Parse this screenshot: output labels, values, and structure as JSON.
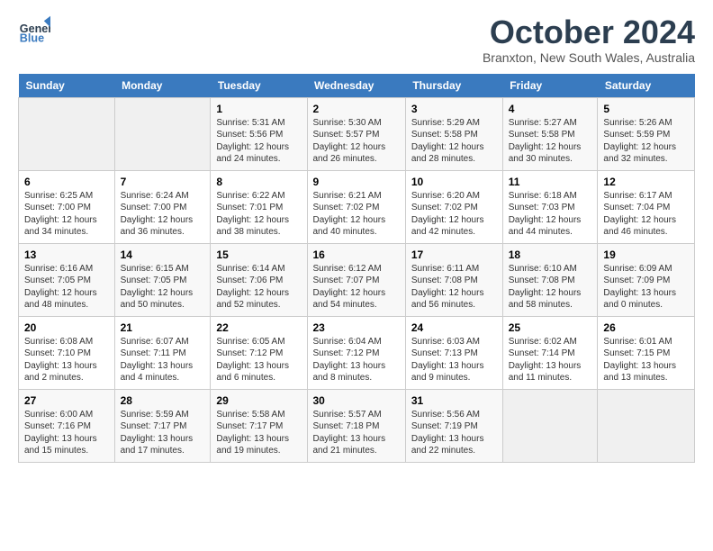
{
  "logo": {
    "line1": "General",
    "line2": "Blue"
  },
  "title": "October 2024",
  "subtitle": "Branxton, New South Wales, Australia",
  "days_of_week": [
    "Sunday",
    "Monday",
    "Tuesday",
    "Wednesday",
    "Thursday",
    "Friday",
    "Saturday"
  ],
  "weeks": [
    [
      {
        "day": "",
        "empty": true
      },
      {
        "day": "",
        "empty": true
      },
      {
        "day": "1",
        "sunrise": "5:31 AM",
        "sunset": "5:56 PM",
        "daylight": "12 hours and 24 minutes."
      },
      {
        "day": "2",
        "sunrise": "5:30 AM",
        "sunset": "5:57 PM",
        "daylight": "12 hours and 26 minutes."
      },
      {
        "day": "3",
        "sunrise": "5:29 AM",
        "sunset": "5:58 PM",
        "daylight": "12 hours and 28 minutes."
      },
      {
        "day": "4",
        "sunrise": "5:27 AM",
        "sunset": "5:58 PM",
        "daylight": "12 hours and 30 minutes."
      },
      {
        "day": "5",
        "sunrise": "5:26 AM",
        "sunset": "5:59 PM",
        "daylight": "12 hours and 32 minutes."
      }
    ],
    [
      {
        "day": "6",
        "sunrise": "6:25 AM",
        "sunset": "7:00 PM",
        "daylight": "12 hours and 34 minutes."
      },
      {
        "day": "7",
        "sunrise": "6:24 AM",
        "sunset": "7:00 PM",
        "daylight": "12 hours and 36 minutes."
      },
      {
        "day": "8",
        "sunrise": "6:22 AM",
        "sunset": "7:01 PM",
        "daylight": "12 hours and 38 minutes."
      },
      {
        "day": "9",
        "sunrise": "6:21 AM",
        "sunset": "7:02 PM",
        "daylight": "12 hours and 40 minutes."
      },
      {
        "day": "10",
        "sunrise": "6:20 AM",
        "sunset": "7:02 PM",
        "daylight": "12 hours and 42 minutes."
      },
      {
        "day": "11",
        "sunrise": "6:18 AM",
        "sunset": "7:03 PM",
        "daylight": "12 hours and 44 minutes."
      },
      {
        "day": "12",
        "sunrise": "6:17 AM",
        "sunset": "7:04 PM",
        "daylight": "12 hours and 46 minutes."
      }
    ],
    [
      {
        "day": "13",
        "sunrise": "6:16 AM",
        "sunset": "7:05 PM",
        "daylight": "12 hours and 48 minutes."
      },
      {
        "day": "14",
        "sunrise": "6:15 AM",
        "sunset": "7:05 PM",
        "daylight": "12 hours and 50 minutes."
      },
      {
        "day": "15",
        "sunrise": "6:14 AM",
        "sunset": "7:06 PM",
        "daylight": "12 hours and 52 minutes."
      },
      {
        "day": "16",
        "sunrise": "6:12 AM",
        "sunset": "7:07 PM",
        "daylight": "12 hours and 54 minutes."
      },
      {
        "day": "17",
        "sunrise": "6:11 AM",
        "sunset": "7:08 PM",
        "daylight": "12 hours and 56 minutes."
      },
      {
        "day": "18",
        "sunrise": "6:10 AM",
        "sunset": "7:08 PM",
        "daylight": "12 hours and 58 minutes."
      },
      {
        "day": "19",
        "sunrise": "6:09 AM",
        "sunset": "7:09 PM",
        "daylight": "13 hours and 0 minutes."
      }
    ],
    [
      {
        "day": "20",
        "sunrise": "6:08 AM",
        "sunset": "7:10 PM",
        "daylight": "13 hours and 2 minutes."
      },
      {
        "day": "21",
        "sunrise": "6:07 AM",
        "sunset": "7:11 PM",
        "daylight": "13 hours and 4 minutes."
      },
      {
        "day": "22",
        "sunrise": "6:05 AM",
        "sunset": "7:12 PM",
        "daylight": "13 hours and 6 minutes."
      },
      {
        "day": "23",
        "sunrise": "6:04 AM",
        "sunset": "7:12 PM",
        "daylight": "13 hours and 8 minutes."
      },
      {
        "day": "24",
        "sunrise": "6:03 AM",
        "sunset": "7:13 PM",
        "daylight": "13 hours and 9 minutes."
      },
      {
        "day": "25",
        "sunrise": "6:02 AM",
        "sunset": "7:14 PM",
        "daylight": "13 hours and 11 minutes."
      },
      {
        "day": "26",
        "sunrise": "6:01 AM",
        "sunset": "7:15 PM",
        "daylight": "13 hours and 13 minutes."
      }
    ],
    [
      {
        "day": "27",
        "sunrise": "6:00 AM",
        "sunset": "7:16 PM",
        "daylight": "13 hours and 15 minutes."
      },
      {
        "day": "28",
        "sunrise": "5:59 AM",
        "sunset": "7:17 PM",
        "daylight": "13 hours and 17 minutes."
      },
      {
        "day": "29",
        "sunrise": "5:58 AM",
        "sunset": "7:17 PM",
        "daylight": "13 hours and 19 minutes."
      },
      {
        "day": "30",
        "sunrise": "5:57 AM",
        "sunset": "7:18 PM",
        "daylight": "13 hours and 21 minutes."
      },
      {
        "day": "31",
        "sunrise": "5:56 AM",
        "sunset": "7:19 PM",
        "daylight": "13 hours and 22 minutes."
      },
      {
        "day": "",
        "empty": true
      },
      {
        "day": "",
        "empty": true
      }
    ]
  ],
  "labels": {
    "sunrise_prefix": "Sunrise: ",
    "sunset_prefix": "Sunset: ",
    "daylight_prefix": "Daylight: "
  }
}
